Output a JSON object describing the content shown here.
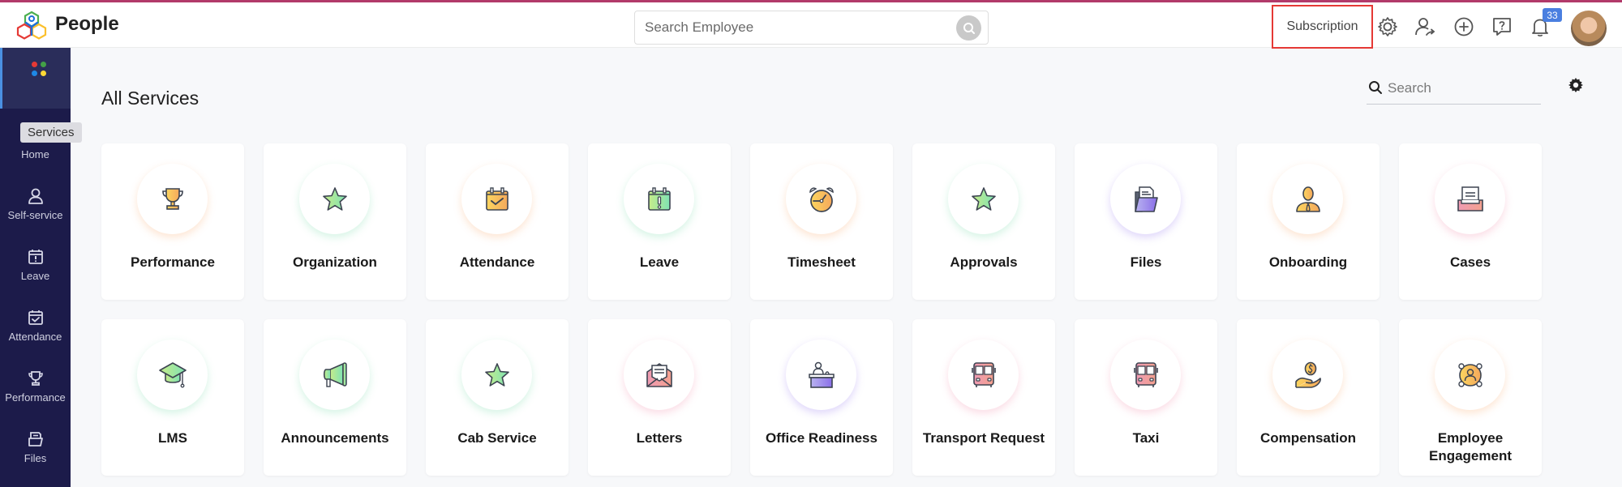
{
  "app": {
    "brand": "People"
  },
  "header": {
    "search_placeholder": "Search Employee",
    "subscription_label": "Subscription",
    "notification_count": "33",
    "icons": [
      "settings-icon",
      "switch-user-icon",
      "add-icon",
      "help-icon",
      "bell-icon"
    ]
  },
  "sidebar": {
    "active": "Services",
    "tooltip": "Services",
    "items": [
      {
        "label": "Home",
        "icon": "home-icon"
      },
      {
        "label": "Self-service",
        "icon": "user-icon"
      },
      {
        "label": "Leave",
        "icon": "leave-calendar-icon"
      },
      {
        "label": "Attendance",
        "icon": "attendance-calendar-icon"
      },
      {
        "label": "Performance",
        "icon": "trophy-icon"
      },
      {
        "label": "Files",
        "icon": "files-icon"
      }
    ]
  },
  "main": {
    "title": "All Services",
    "search_placeholder": "Search",
    "services": [
      {
        "name": "Performance",
        "icon": "trophy-icon",
        "accent": "#f6b26b"
      },
      {
        "name": "Organization",
        "icon": "star-icon",
        "accent": "#7ddc9e"
      },
      {
        "name": "Attendance",
        "icon": "calendar-check-icon",
        "accent": "#f6b26b"
      },
      {
        "name": "Leave",
        "icon": "calendar-alert-icon",
        "accent": "#7ddc9e"
      },
      {
        "name": "Timesheet",
        "icon": "alarm-clock-icon",
        "accent": "#f6b26b"
      },
      {
        "name": "Approvals",
        "icon": "star-icon",
        "accent": "#7ddc9e"
      },
      {
        "name": "Files",
        "icon": "folder-icon",
        "accent": "#9a86ef"
      },
      {
        "name": "Onboarding",
        "icon": "employee-icon",
        "accent": "#f6b26b"
      },
      {
        "name": "Cases",
        "icon": "inbox-tray-icon",
        "accent": "#f08fa0"
      },
      {
        "name": "LMS",
        "icon": "graduation-cap-icon",
        "accent": "#7ddc9e"
      },
      {
        "name": "Announcements",
        "icon": "megaphone-icon",
        "accent": "#7ddc9e"
      },
      {
        "name": "Cab Service",
        "icon": "star-icon",
        "accent": "#7ddc9e"
      },
      {
        "name": "Letters",
        "icon": "envelope-letter-icon",
        "accent": "#f08fa0"
      },
      {
        "name": "Office Readiness",
        "icon": "reception-desk-icon",
        "accent": "#9a86ef"
      },
      {
        "name": "Transport Request",
        "icon": "bus-icon",
        "accent": "#f08fa0"
      },
      {
        "name": "Taxi",
        "icon": "bus-icon",
        "accent": "#f08fa0"
      },
      {
        "name": "Compensation",
        "icon": "hand-coin-icon",
        "accent": "#f6b26b"
      },
      {
        "name": "Employee Engagement",
        "icon": "engagement-icon",
        "accent": "#f6b26b"
      }
    ]
  }
}
